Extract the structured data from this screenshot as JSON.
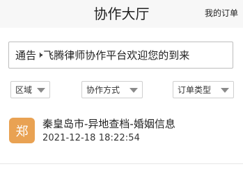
{
  "header": {
    "title": "协作大厅",
    "my_orders": "我的订单"
  },
  "notice": {
    "prefix": "通告",
    "speaker_icon": "speaker-icon",
    "text": "飞腾律师协作平台欢迎您的到来"
  },
  "filters": [
    {
      "label": "区域"
    },
    {
      "label": "协作方式"
    },
    {
      "label": "订单类型"
    }
  ],
  "orders": [
    {
      "avatar_text": "郑",
      "avatar_color": "#e9a253",
      "title": "秦皇岛市-异地查档-婚姻信息",
      "time": "2021-12-18   18:22:54"
    }
  ]
}
